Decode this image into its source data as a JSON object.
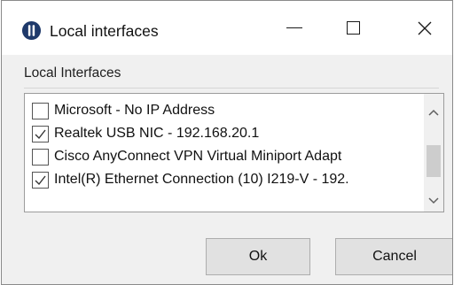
{
  "window": {
    "title": "Local interfaces",
    "app_icon": "pause-circle-icon",
    "controls": {
      "minimize": "minimize-icon",
      "maximize": "maximize-icon",
      "close": "close-icon"
    }
  },
  "group": {
    "label": "Local Interfaces"
  },
  "interfaces": [
    {
      "label": "Microsoft - No IP Address",
      "checked": false
    },
    {
      "label": "Realtek USB NIC - 192.168.20.1",
      "checked": true
    },
    {
      "label": "Cisco AnyConnect VPN Virtual Miniport Adapt",
      "checked": false
    },
    {
      "label": "Intel(R) Ethernet Connection (10) I219-V - 192.",
      "checked": true
    }
  ],
  "buttons": {
    "ok": "Ok",
    "cancel": "Cancel"
  },
  "colors": {
    "window_bg": "#f0f0f0",
    "titlebar_bg": "#ffffff",
    "button_bg": "#e1e1e1"
  }
}
